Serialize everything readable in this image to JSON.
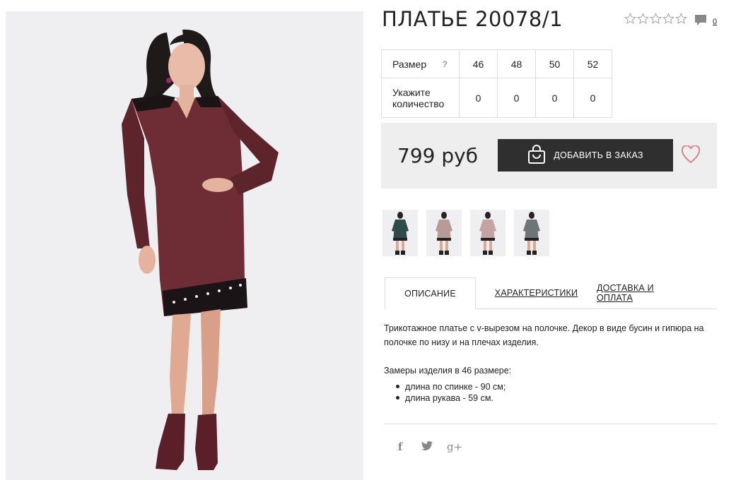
{
  "product": {
    "title": "ПЛАТЬЕ 20078/1",
    "rating": {
      "value": 0,
      "max": 5
    },
    "comments_count": "0"
  },
  "sizes": {
    "size_label": "Размер",
    "help_symbol": "?",
    "quantity_label": "Укажите количество",
    "columns": [
      "46",
      "48",
      "50",
      "52"
    ],
    "quantities": [
      "0",
      "0",
      "0",
      "0"
    ]
  },
  "purchase": {
    "price": "799 руб",
    "add_button_label": "ДОБАВИТЬ В ЗАКАЗ"
  },
  "thumbnails": [
    {
      "color": "#2f4a4a"
    },
    {
      "color": "#b89a96"
    },
    {
      "color": "#c4a3a3"
    },
    {
      "color": "#6f7577"
    }
  ],
  "tabs": [
    {
      "label": "ОПИСАНИЕ",
      "active": true
    },
    {
      "label": "ХАРАКТЕРИСТИКИ",
      "active": false
    },
    {
      "label": "ДОСТАВКА И ОПЛАТА",
      "active": false
    }
  ],
  "description": {
    "text": "Трикотажное платье с v-вырезом на полочке. Декор в виде бусин и гипюра на полочке по низу и на плечах изделия.",
    "measures_title": "Замеры изделия в 46 размере:",
    "measures": [
      "длина по спинке - 90 см;",
      "длина рукава - 59 см."
    ]
  },
  "social": {
    "facebook": "f",
    "twitter": "twitter-icon",
    "googleplus": "g+"
  },
  "colors": {
    "dress": "#6e2c34",
    "accent_heart": "#d9838f",
    "button_bg": "#2f2f2f",
    "price_bg": "#eeeeee"
  }
}
